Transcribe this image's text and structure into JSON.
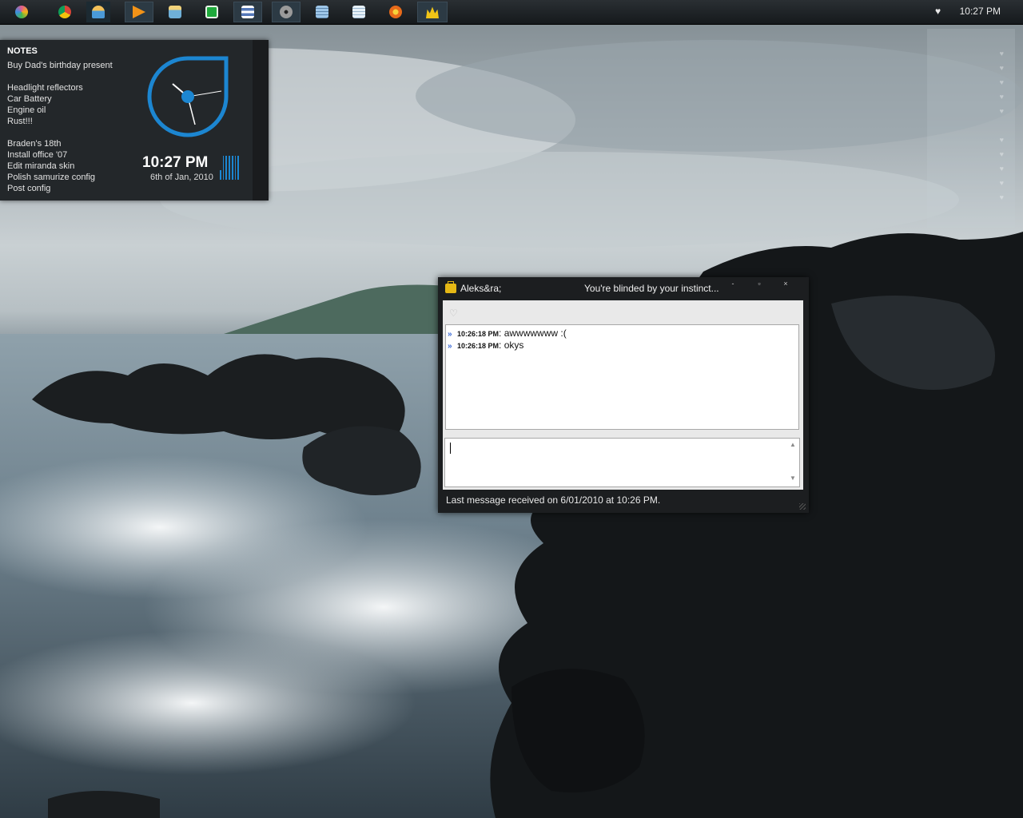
{
  "taskbar": {
    "icons": [
      {
        "name": "start-orb-icon",
        "color": "#e35b8e"
      },
      {
        "name": "chrome-icon",
        "color": "#d8c42a"
      },
      {
        "name": "users-icon",
        "color": "#4a9ad8"
      },
      {
        "name": "media-player-icon",
        "color": "#f29318"
      },
      {
        "name": "explorer-icon",
        "color": "#6fb0d8"
      },
      {
        "name": "spreadsheet-icon",
        "color": "#1faa3c"
      },
      {
        "name": "document-icon",
        "color": "#5478b8"
      },
      {
        "name": "disc-icon",
        "color": "#8a8a8a"
      },
      {
        "name": "calculator-icon",
        "color": "#9ec6e8"
      },
      {
        "name": "notepad-icon",
        "color": "#cfe3f2"
      },
      {
        "name": "firefox-icon",
        "color": "#e86a1a"
      },
      {
        "name": "miranda-icon",
        "color": "#f1c416"
      }
    ],
    "clock": "10:27 PM"
  },
  "notes": {
    "title": "NOTES",
    "lines": [
      "Buy Dad's birthday present",
      "",
      "Headlight reflectors",
      "Car Battery",
      "Engine oil",
      "Rust!!!",
      "",
      "Braden's 18th",
      "Install office '07",
      "Edit miranda skin",
      "Polish samurize config",
      "Post config"
    ],
    "time": "10:27 PM",
    "date": "6th of Jan, 2010",
    "accent": "#1c86d1"
  },
  "chat": {
    "contact": "Aleks&ra;",
    "status_message": "You're blinded by your instinct...",
    "controls": [
      "-",
      "▫",
      "×"
    ],
    "messages": [
      {
        "time": "10:26:18 PM",
        "text": "awwwwwww :("
      },
      {
        "time": "10:26:18 PM",
        "text": "okys"
      }
    ],
    "input_value": "",
    "status_bar": "Last message received on 6/01/2010 at 10:26 PM."
  }
}
